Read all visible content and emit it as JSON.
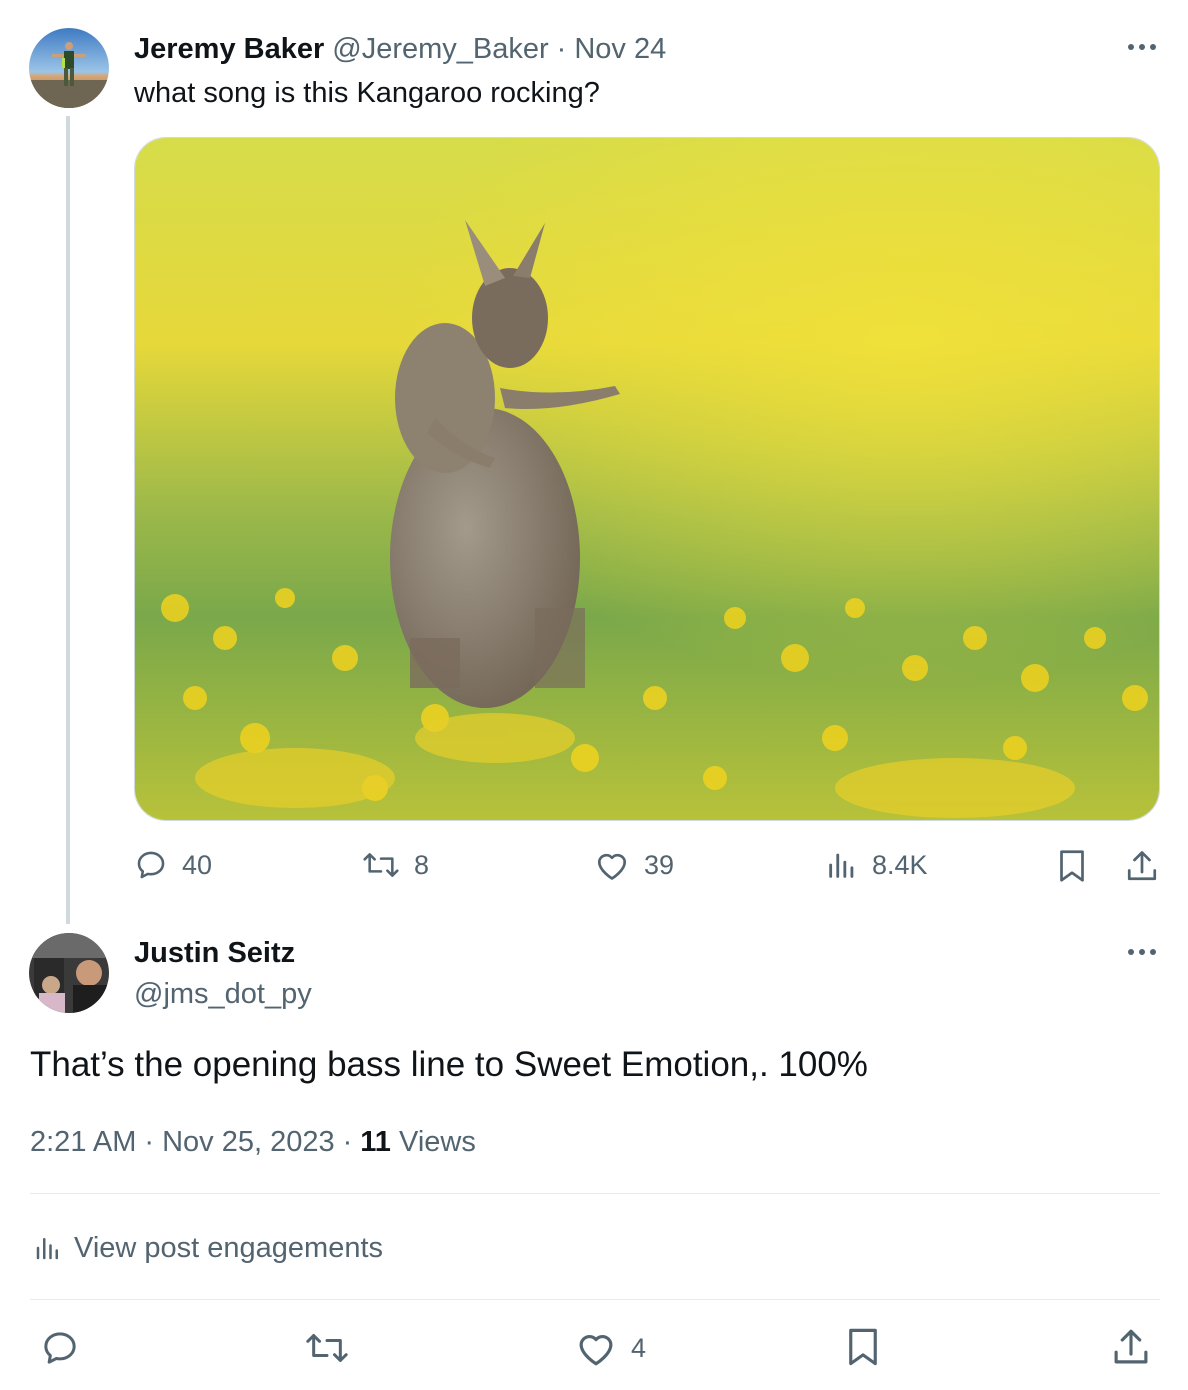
{
  "parent_post": {
    "author_name": "Jeremy Baker",
    "handle": "@Jeremy_Baker",
    "separator": "·",
    "date": "Nov 24",
    "text": "what song is this Kangaroo rocking?",
    "media_alt": "kangaroo standing in a field of yellow flowers",
    "actions": {
      "replies": "40",
      "reposts": "8",
      "likes": "39",
      "views": "8.4K"
    }
  },
  "reply_post": {
    "author_name": "Justin Seitz",
    "handle": "@jms_dot_py",
    "text": "That’s the opening bass line to Sweet Emotion,. 100%",
    "time": "2:21 AM",
    "separator1": "·",
    "date": "Nov 25, 2023",
    "separator2": "·",
    "views_count": "11",
    "views_label": "Views",
    "engagements_link": "View post engagements",
    "actions": {
      "likes": "4"
    }
  },
  "colors": {
    "text_primary": "#0f1419",
    "text_secondary": "#536471",
    "thread_line": "#cfd9de",
    "divider": "#e6eaed"
  },
  "icons": [
    "more-icon",
    "reply-icon",
    "repost-icon",
    "like-icon",
    "views-icon",
    "bookmark-icon",
    "share-icon"
  ]
}
